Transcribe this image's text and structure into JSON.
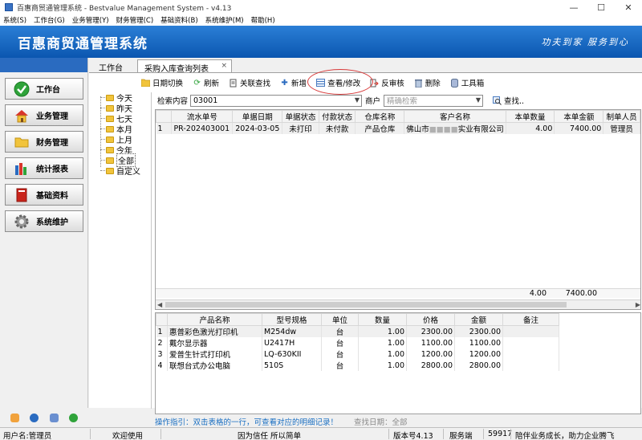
{
  "window": {
    "title": "百惠商贸通管理系统 - Bestvalue Management System - v4.13",
    "minimize": "—",
    "maximize": "☐",
    "close": "✕"
  },
  "menu": [
    "系统(S)",
    "工作台(G)",
    "业务管理(Y)",
    "财务管理(C)",
    "基础资料(B)",
    "系统维护(M)",
    "帮助(H)"
  ],
  "banner": {
    "brand": "百惠商贸通管理系统",
    "slogan": "功夫到家  服务到心"
  },
  "sidebar": {
    "items": [
      {
        "label": "工作台",
        "icon": "check-circle-icon"
      },
      {
        "label": "业务管理",
        "icon": "house-icon"
      },
      {
        "label": "财务管理",
        "icon": "folder-icon"
      },
      {
        "label": "统计报表",
        "icon": "chart-books-icon"
      },
      {
        "label": "基础资料",
        "icon": "red-book-icon"
      },
      {
        "label": "系统维护",
        "icon": "gear-icon"
      }
    ]
  },
  "tabs": {
    "workbench": "工作台",
    "active": "采购入库查询列表",
    "close": "×"
  },
  "toolbar": {
    "date_switch": "日期切换",
    "refresh": "刷新",
    "related_search": "关联查找",
    "add": "新增",
    "view_edit": "查看/修改",
    "unaudit": "反审核",
    "delete": "删除",
    "toolbox": "工具箱"
  },
  "tree": {
    "items": [
      "今天",
      "昨天",
      "七天",
      "本月",
      "上月",
      "今年",
      "全部",
      "自定义"
    ],
    "selected": "全部"
  },
  "search": {
    "content_label": "检索内容",
    "content_value": "03001",
    "merchant_label": "商户",
    "merchant_placeholder": "精确检索",
    "search_button": "查找.."
  },
  "orders": {
    "columns": [
      "",
      "流水单号",
      "单据日期",
      "单据状态",
      "付款状态",
      "仓库名称",
      "客户名称",
      "本单数量",
      "本单金额",
      "制单人员"
    ],
    "rows": [
      {
        "idx": "1",
        "no": "PR-202403001",
        "date": "2024-03-05",
        "status": "未打印",
        "pay": "未付款",
        "warehouse": "产品仓库",
        "customer_a": "佛山市",
        "customer_blur": "■■■■",
        "customer_b": "实业有限公司",
        "qty": "4.00",
        "amount": "7400.00",
        "maker": "管理员"
      }
    ],
    "total_qty": "4.00",
    "total_amount": "7400.00"
  },
  "details": {
    "columns": [
      "",
      "产品名称",
      "型号规格",
      "单位",
      "数量",
      "价格",
      "金额",
      "备注"
    ],
    "rows": [
      {
        "idx": "1",
        "name": "惠普彩色激光打印机",
        "model": "M254dw",
        "unit": "台",
        "qty": "1.00",
        "price": "2300.00",
        "amount": "2300.00",
        "note": ""
      },
      {
        "idx": "2",
        "name": "戴尔显示器",
        "model": "U2417H",
        "unit": "台",
        "qty": "1.00",
        "price": "1100.00",
        "amount": "1100.00",
        "note": ""
      },
      {
        "idx": "3",
        "name": "爱普生针式打印机",
        "model": "LQ-630KII",
        "unit": "台",
        "qty": "1.00",
        "price": "1200.00",
        "amount": "1200.00",
        "note": ""
      },
      {
        "idx": "4",
        "name": "联想台式办公电脑",
        "model": "510S",
        "unit": "台",
        "qty": "1.00",
        "price": "2800.00",
        "amount": "2800.00",
        "note": ""
      }
    ]
  },
  "guide": {
    "text": "操作指引：双击表格的一行，可查看对应的明细记录！",
    "find_date": "查找日期：全部"
  },
  "status": {
    "user": "用户名:管理员",
    "welcome": "欢迎使用",
    "motto": "因为信任 所以简单",
    "version": "版本号4.13",
    "service": "服务端",
    "port": "59917",
    "tagline": "陪伴业务成长，助力企业腾飞"
  },
  "colors": {
    "banner": "#0b56b0",
    "guide_text": "#1a6fc2",
    "highlight": "#d83a3a"
  }
}
